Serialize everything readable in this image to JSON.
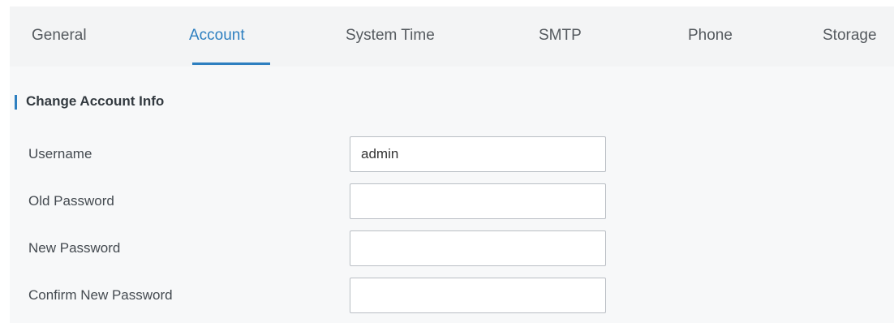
{
  "tabs": [
    {
      "label": "General",
      "active": false
    },
    {
      "label": "Account",
      "active": true
    },
    {
      "label": "System Time",
      "active": false
    },
    {
      "label": "SMTP",
      "active": false
    },
    {
      "label": "Phone",
      "active": false
    },
    {
      "label": "Storage",
      "active": false
    }
  ],
  "colors": {
    "accent": "#2d7fc0",
    "tabbar_bg": "#f3f4f5",
    "section_bg": "#f7f8f9"
  },
  "section": {
    "title": "Change Account Info",
    "fields": [
      {
        "label": "Username",
        "value": "admin",
        "type": "text"
      },
      {
        "label": "Old Password",
        "value": "",
        "type": "password"
      },
      {
        "label": "New Password",
        "value": "",
        "type": "password"
      },
      {
        "label": "Confirm New Password",
        "value": "",
        "type": "password"
      }
    ]
  }
}
